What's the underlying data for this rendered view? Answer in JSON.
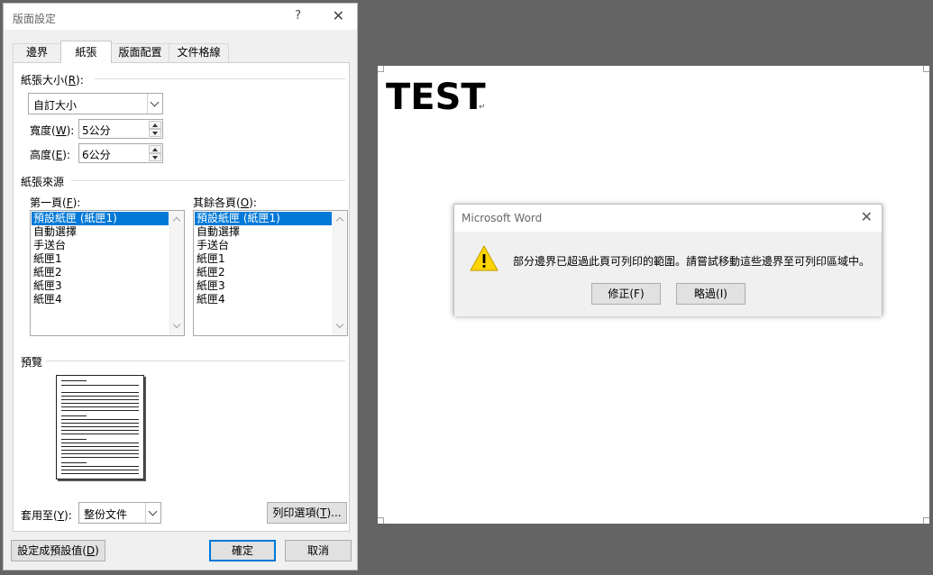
{
  "dialog": {
    "title": "版面設定",
    "help": "?",
    "close": "✕",
    "tabs": [
      {
        "label": "邊界"
      },
      {
        "label": "紙張"
      },
      {
        "label": "版面配置"
      },
      {
        "label": "文件格線"
      }
    ],
    "paper_size": {
      "label_prefix": "紙張大小(",
      "mnemonic": "R",
      "label_suffix": "):",
      "value": "自訂大小"
    },
    "width": {
      "label_prefix": "寬度(",
      "mnemonic": "W",
      "label_suffix": "):",
      "value": "5公分"
    },
    "height": {
      "label_prefix": "高度(",
      "mnemonic": "E",
      "label_suffix": "):",
      "value": "6公分"
    },
    "paper_source": {
      "label": "紙張來源",
      "first_page": {
        "label_prefix": "第一頁(",
        "mnemonic": "F",
        "label_suffix": "):",
        "items": [
          "預設紙匣 (紙匣1)",
          "自動選擇",
          "手送台",
          "紙匣1",
          "紙匣2",
          "紙匣3",
          "紙匣4"
        ]
      },
      "other_pages": {
        "label_prefix": "其餘各頁(",
        "mnemonic": "O",
        "label_suffix": "):",
        "items": [
          "預設紙匣 (紙匣1)",
          "自動選擇",
          "手送台",
          "紙匣1",
          "紙匣2",
          "紙匣3",
          "紙匣4"
        ]
      }
    },
    "preview": {
      "label": "預覽"
    },
    "apply_to": {
      "label_prefix": "套用至(",
      "mnemonic": "Y",
      "label_suffix": "):",
      "value": "整份文件"
    },
    "print_options": {
      "prefix": "列印選項(",
      "mnemonic": "T",
      "suffix": ")..."
    },
    "set_default": {
      "prefix": "設定成預設值(",
      "mnemonic": "D",
      "suffix": ")"
    },
    "ok": "確定",
    "cancel": "取消"
  },
  "document": {
    "text": "TEST",
    "paragraph_mark": "↵"
  },
  "message_box": {
    "title": "Microsoft Word",
    "close": "✕",
    "message": "部分邊界已超過此頁可列印的範圍。請嘗試移動這些邊界至可列印區域中。",
    "fix_button": "修正(F)",
    "ignore_button": "略過(I)"
  }
}
